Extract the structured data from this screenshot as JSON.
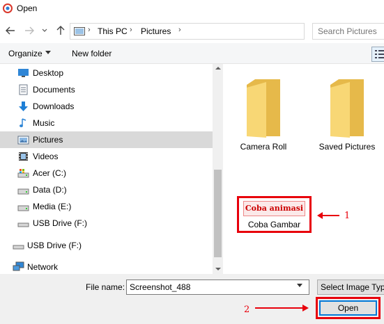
{
  "window": {
    "title": "Open"
  },
  "nav": {
    "back_icon": "arrow-left-icon",
    "forward_icon": "arrow-right-icon",
    "up_icon": "arrow-up-icon",
    "breadcrumb": [
      "This PC",
      "Pictures"
    ],
    "search_placeholder": "Search Pictures"
  },
  "toolbar": {
    "organize_label": "Organize",
    "new_folder_label": "New folder"
  },
  "sidebar": {
    "items": [
      {
        "label": "Desktop",
        "icon": "desktop-icon",
        "level": 1
      },
      {
        "label": "Documents",
        "icon": "documents-icon",
        "level": 1
      },
      {
        "label": "Downloads",
        "icon": "downloads-icon",
        "level": 1
      },
      {
        "label": "Music",
        "icon": "music-icon",
        "level": 1
      },
      {
        "label": "Pictures",
        "icon": "pictures-icon",
        "level": 1,
        "selected": true
      },
      {
        "label": "Videos",
        "icon": "videos-icon",
        "level": 1
      },
      {
        "label": "Acer (C:)",
        "icon": "drive-icon",
        "level": 1
      },
      {
        "label": "Data (D:)",
        "icon": "drive-icon",
        "level": 1
      },
      {
        "label": "Media (E:)",
        "icon": "drive-icon",
        "level": 1
      },
      {
        "label": "USB Drive (F:)",
        "icon": "usb-drive-icon",
        "level": 1
      },
      {
        "label": "USB Drive (F:)",
        "icon": "usb-drive-icon",
        "level": 0
      },
      {
        "label": "Network",
        "icon": "network-icon",
        "level": 0
      }
    ]
  },
  "content": {
    "folders": [
      {
        "label": "Camera Roll"
      },
      {
        "label": "Saved Pictures"
      }
    ],
    "file": {
      "thumbnail_text": "Coba animasi",
      "label": "Coba Gambar"
    }
  },
  "annotations": {
    "label_1": "1",
    "label_2": "2",
    "color": "#e8000b"
  },
  "footer": {
    "file_name_label": "File name:",
    "file_name_value": "Screenshot_488",
    "file_type_value": "Select Image Type",
    "open_label": "Open"
  },
  "colors": {
    "selection": "#d9d9d9",
    "folder": "#f8d775",
    "folder_dark": "#e6b94a",
    "accent": "#0078d7"
  }
}
